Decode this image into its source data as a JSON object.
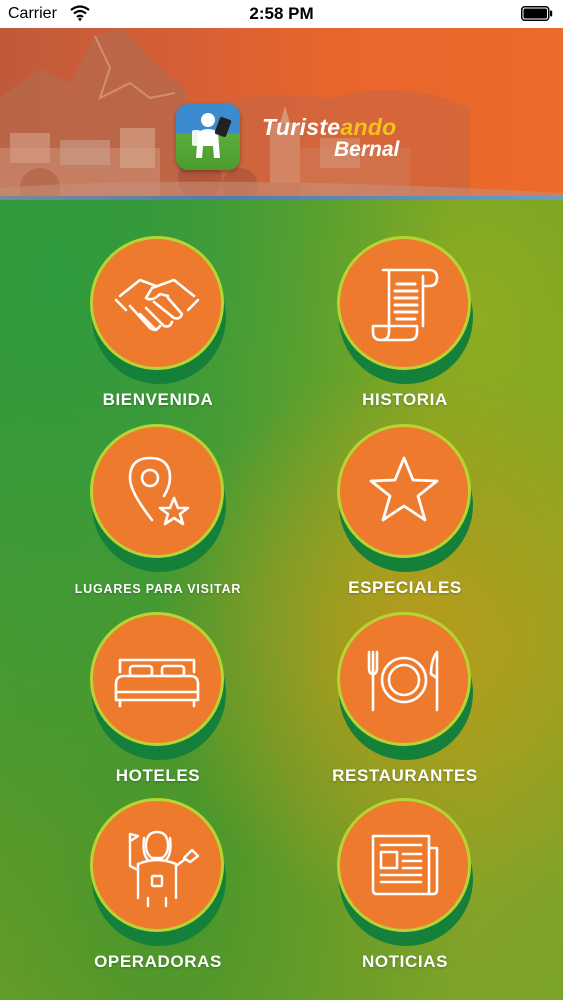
{
  "status_bar": {
    "carrier": "Carrier",
    "time": "2:58 PM"
  },
  "header": {
    "brand_part1": "Turiste",
    "brand_part2": "ando",
    "brand_line2": "Bernal"
  },
  "colors": {
    "orange": "#ee7a2d",
    "ring": "#b7d433",
    "shadow_green": "#15803a",
    "label_text": "#ffffff"
  },
  "menu": {
    "items": [
      {
        "label": "BIENVENIDA",
        "icon": "handshake-icon"
      },
      {
        "label": "HISTORIA",
        "icon": "scroll-icon"
      },
      {
        "label": "LUGARES PARA VISITAR",
        "icon": "map-pin-star-icon"
      },
      {
        "label": "ESPECIALES",
        "icon": "star-icon"
      },
      {
        "label": "HOTELES",
        "icon": "bed-icon"
      },
      {
        "label": "RESTAURANTES",
        "icon": "plate-cutlery-icon"
      },
      {
        "label": "OPERADORAS",
        "icon": "tour-guide-icon"
      },
      {
        "label": "NOTICIAS",
        "icon": "newspaper-icon"
      }
    ]
  }
}
